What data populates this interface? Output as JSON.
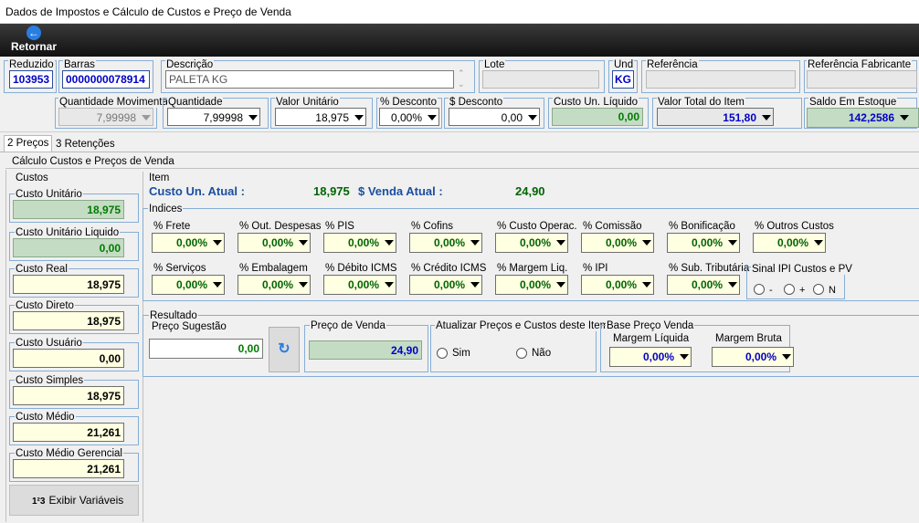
{
  "window": {
    "title": "Dados de Impostos e Cálculo de Custos e Preço de Venda"
  },
  "toolbar": {
    "back_label": "Retornar"
  },
  "header": {
    "reduzido_label": "Reduzido",
    "reduzido": "103953",
    "barras_label": "Barras",
    "barras": "0000000078914",
    "descricao_label": "Descrição",
    "descricao": "PALETA KG",
    "lote_label": "Lote",
    "lote": "",
    "und_label": "Und",
    "und": "KG",
    "referencia_label": "Referência",
    "referencia": "",
    "ref_fab_label": "Referência Fabricante",
    "ref_fab": ""
  },
  "row2": {
    "qtd_mov_label": "Quantidade Movimenta",
    "qtd_mov": "7,99998",
    "quantidade_label": "Quantidade",
    "quantidade": "7,99998",
    "valor_unit_label": "Valor Unitário",
    "valor_unit": "18,975",
    "pct_desc_label": "% Desconto",
    "pct_desc": "0,00%",
    "val_desc_label": "$ Desconto",
    "val_desc": "0,00",
    "custo_liq_label": "Custo Un. Líquido",
    "custo_liq": "0,00",
    "valor_total_label": "Valor Total do Item",
    "valor_total": "151,80",
    "saldo_label": "Saldo Em Estoque",
    "saldo": "142,2586"
  },
  "tabs": [
    {
      "label": "2 Preços"
    },
    {
      "label": "3 Retenções"
    }
  ],
  "main_title": "Cálculo Custos e Preços de Venda",
  "custos": {
    "title": "Custos",
    "items": [
      {
        "label": "Custo Unitário",
        "value": "18,975"
      },
      {
        "label": "Custo Unitário Liquido",
        "value": "0,00"
      },
      {
        "label": "Custo Real",
        "value": "18,975"
      },
      {
        "label": "Custo Direto",
        "value": "18,975"
      },
      {
        "label": "Custo Usuário",
        "value": "0,00"
      },
      {
        "label": "Custo Simples",
        "value": "18,975"
      },
      {
        "label": "Custo Médio",
        "value": "21,261"
      },
      {
        "label": "Custo Médio Gerencial",
        "value": "21,261"
      }
    ],
    "exibir_label": "Exibir Variáveis",
    "exibir_icon": "1²3"
  },
  "item": {
    "title": "Item",
    "custo_atual_label": "Custo Un. Atual :",
    "custo_atual": "18,975",
    "venda_atual_label": "$ Venda Atual :",
    "venda_atual": "24,90"
  },
  "indices": {
    "title": "Indices",
    "row1": [
      {
        "label": "% Frete",
        "value": "0,00%"
      },
      {
        "label": "% Out. Despesas",
        "value": "0,00%"
      },
      {
        "label": "% PIS",
        "value": "0,00%"
      },
      {
        "label": "% Cofins",
        "value": "0,00%"
      },
      {
        "label": "% Custo Operac.",
        "value": "0,00%"
      },
      {
        "label": "% Comissão",
        "value": "0,00%"
      },
      {
        "label": "% Bonificação",
        "value": "0,00%"
      },
      {
        "label": "% Outros Custos",
        "value": "0,00%"
      }
    ],
    "row2": [
      {
        "label": "% Serviços",
        "value": "0,00%"
      },
      {
        "label": "% Embalagem",
        "value": "0,00%"
      },
      {
        "label": "% Débito ICMS",
        "value": "0,00%"
      },
      {
        "label": "% Crédito ICMS",
        "value": "0,00%"
      },
      {
        "label": "% Margem Liq.",
        "value": "0,00%"
      },
      {
        "label": "% IPI",
        "value": "0,00%"
      },
      {
        "label": "% Sub. Tributária",
        "value": "0,00%"
      }
    ],
    "sinal_label": "Sinal IPI Custos e PV",
    "sinal_opts": [
      "-",
      "+",
      "N"
    ]
  },
  "resultado": {
    "title": "Resultado",
    "preco_sug_label": "Preço Sugestão",
    "preco_sug": "0,00",
    "preco_venda_label": "Preço de Venda",
    "preco_venda": "24,90",
    "atualizar_label": "Atualizar Preços e Custos deste Item",
    "sim": "Sim",
    "nao": "Não",
    "base_label": "Base Preço Venda",
    "margem_liq_label": "Margem Líquida",
    "margem_liq": "0,00%",
    "margem_bruta_label": "Margem Bruta",
    "margem_bruta": "0,00%"
  }
}
